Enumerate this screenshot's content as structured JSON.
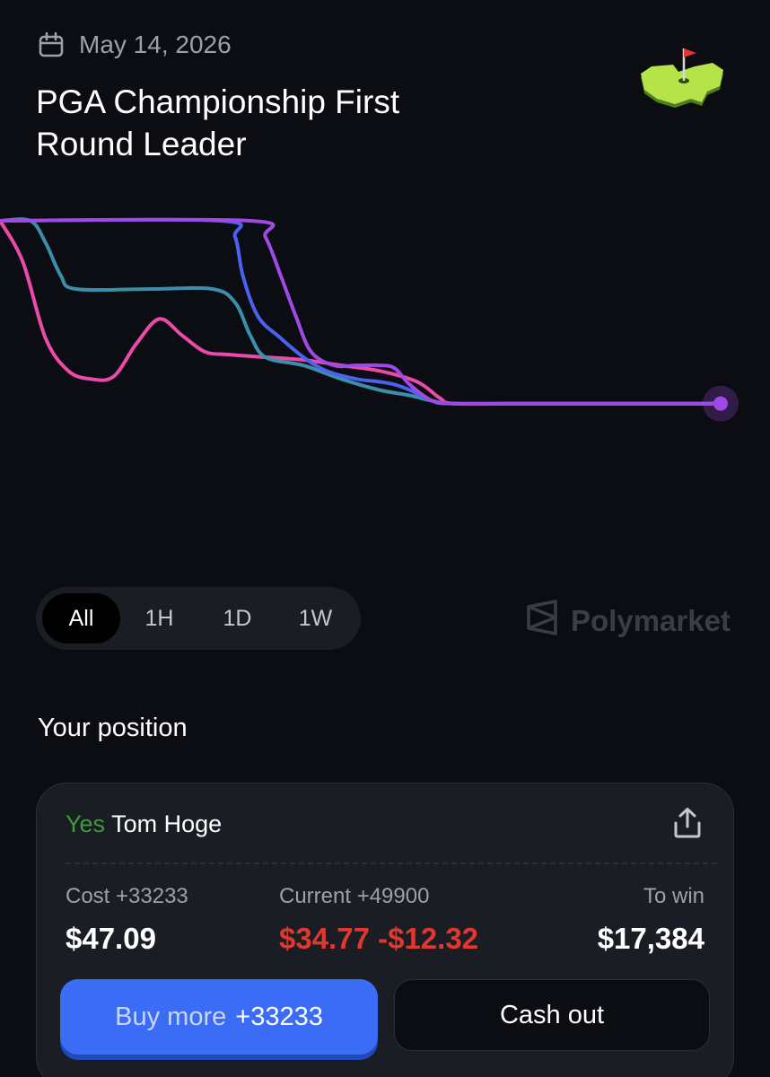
{
  "header": {
    "date": "May 14, 2026",
    "title": "PGA Championship First Round Leader"
  },
  "icons": {
    "calendar": "calendar-icon",
    "badge": "golf-flag-map-icon",
    "share": "share-icon",
    "logo": "polymarket-logo-icon"
  },
  "colors": {
    "background": "#0b0d12",
    "card": "#1b1d24",
    "accent": "#3b6cf6",
    "positive": "#3e9b3a",
    "negative": "#e0372f",
    "series": [
      "#ec4aa8",
      "#3b8fa8",
      "#4b62f0",
      "#a04ae6"
    ]
  },
  "range_tabs": [
    {
      "label": "All",
      "active": true
    },
    {
      "label": "1H",
      "active": false
    },
    {
      "label": "1D",
      "active": false
    },
    {
      "label": "1W",
      "active": false
    }
  ],
  "brand": "Polymarket",
  "position": {
    "section_title": "Your position",
    "side": "Yes",
    "outcome": "Tom Hoge",
    "cost_label": "Cost +33233",
    "cost_value": "$47.09",
    "current_label": "Current +49900",
    "current_value": "$34.77",
    "current_change": "-$12.32",
    "to_win_label": "To win",
    "to_win_value": "$17,384",
    "buy_label": "Buy more",
    "buy_amount": "+33233",
    "cashout_label": "Cash out"
  },
  "chart_data": {
    "type": "line",
    "ylim": [
      0,
      100
    ],
    "grid": false,
    "series": [
      {
        "color": "#ec4aa8",
        "points": [
          [
            0,
            100
          ],
          [
            3,
            85
          ],
          [
            6,
            57
          ],
          [
            9,
            45
          ],
          [
            12,
            42
          ],
          [
            15,
            43
          ],
          [
            18,
            55
          ],
          [
            21,
            64
          ],
          [
            24,
            58
          ],
          [
            27,
            52
          ],
          [
            30,
            51
          ],
          [
            35,
            50
          ],
          [
            40,
            49
          ],
          [
            45,
            47
          ],
          [
            50,
            45
          ],
          [
            55,
            41
          ],
          [
            58,
            35
          ],
          [
            60,
            33
          ],
          [
            70,
            33
          ],
          [
            80,
            33
          ],
          [
            90,
            33
          ],
          [
            95,
            33
          ]
        ]
      },
      {
        "color": "#3b8fa8",
        "points": [
          [
            0,
            100
          ],
          [
            4,
            100
          ],
          [
            6,
            92
          ],
          [
            8,
            80
          ],
          [
            10,
            75
          ],
          [
            20,
            75
          ],
          [
            28,
            75
          ],
          [
            31,
            70
          ],
          [
            33,
            58
          ],
          [
            35,
            50
          ],
          [
            40,
            47
          ],
          [
            45,
            42
          ],
          [
            50,
            38
          ],
          [
            54,
            36
          ],
          [
            57,
            34
          ],
          [
            60,
            33
          ],
          [
            70,
            33
          ],
          [
            80,
            33
          ],
          [
            90,
            33
          ],
          [
            95,
            33
          ]
        ]
      },
      {
        "color": "#4b62f0",
        "points": [
          [
            0,
            100
          ],
          [
            29,
            100
          ],
          [
            31,
            94
          ],
          [
            32,
            80
          ],
          [
            34,
            65
          ],
          [
            37,
            57
          ],
          [
            40,
            50
          ],
          [
            43,
            45
          ],
          [
            47,
            42
          ],
          [
            50,
            41
          ],
          [
            52,
            40
          ],
          [
            54,
            38
          ],
          [
            57,
            34
          ],
          [
            60,
            33
          ],
          [
            70,
            33
          ],
          [
            80,
            33
          ],
          [
            90,
            33
          ],
          [
            95,
            33
          ]
        ]
      },
      {
        "color": "#a04ae6",
        "points": [
          [
            0,
            100
          ],
          [
            33,
            100
          ],
          [
            35,
            94
          ],
          [
            37,
            80
          ],
          [
            39,
            65
          ],
          [
            41,
            52
          ],
          [
            44,
            47
          ],
          [
            47,
            47
          ],
          [
            50,
            47
          ],
          [
            52,
            46
          ],
          [
            54,
            40
          ],
          [
            57,
            34
          ],
          [
            60,
            33
          ],
          [
            70,
            33
          ],
          [
            80,
            33
          ],
          [
            90,
            33
          ],
          [
            95,
            33
          ]
        ]
      }
    ]
  }
}
